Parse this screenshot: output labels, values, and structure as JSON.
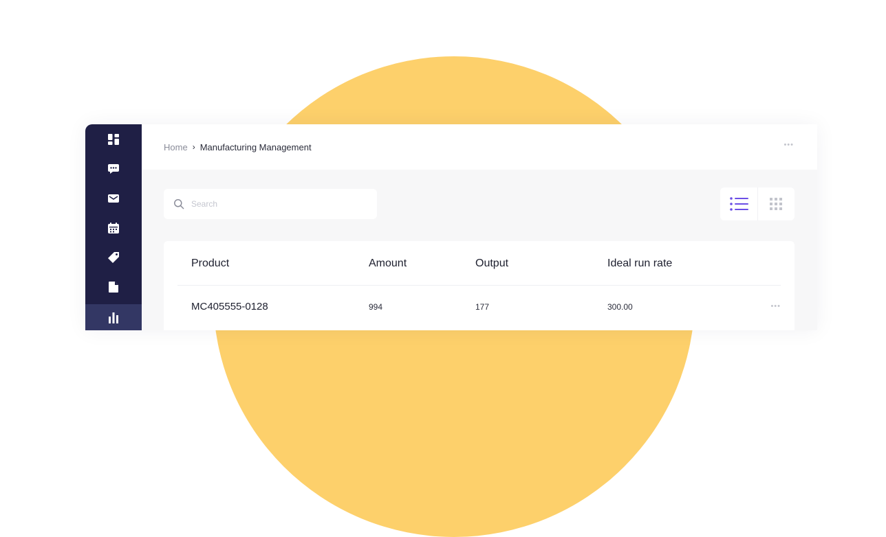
{
  "breadcrumb": {
    "home": "Home",
    "separator": "›",
    "current": "Manufacturing Management"
  },
  "topbar": {
    "more_label": "•••"
  },
  "search": {
    "placeholder": "Search",
    "icon": "search-icon"
  },
  "view_toggle": {
    "options": [
      "list-view",
      "grid-view"
    ],
    "selected": "list-view"
  },
  "sidebar": {
    "items": [
      {
        "icon": "dashboard-icon",
        "active": false
      },
      {
        "icon": "chat-icon",
        "active": false
      },
      {
        "icon": "mail-icon",
        "active": false
      },
      {
        "icon": "calendar-icon",
        "active": false
      },
      {
        "icon": "tag-icon",
        "active": false
      },
      {
        "icon": "document-icon",
        "active": false
      },
      {
        "icon": "bar-chart-icon",
        "active": true
      }
    ]
  },
  "table": {
    "columns": [
      "Product",
      "Amount",
      "Output",
      "Ideal run rate"
    ],
    "rows": [
      {
        "product": "MC405555-0128",
        "amount": "994",
        "output": "177",
        "ideal_run_rate": "300.00",
        "more": "•••"
      }
    ]
  },
  "colors": {
    "accent": "#6b4ee6",
    "sidebar": "#1f1f45",
    "sun": "#fdd06b"
  }
}
